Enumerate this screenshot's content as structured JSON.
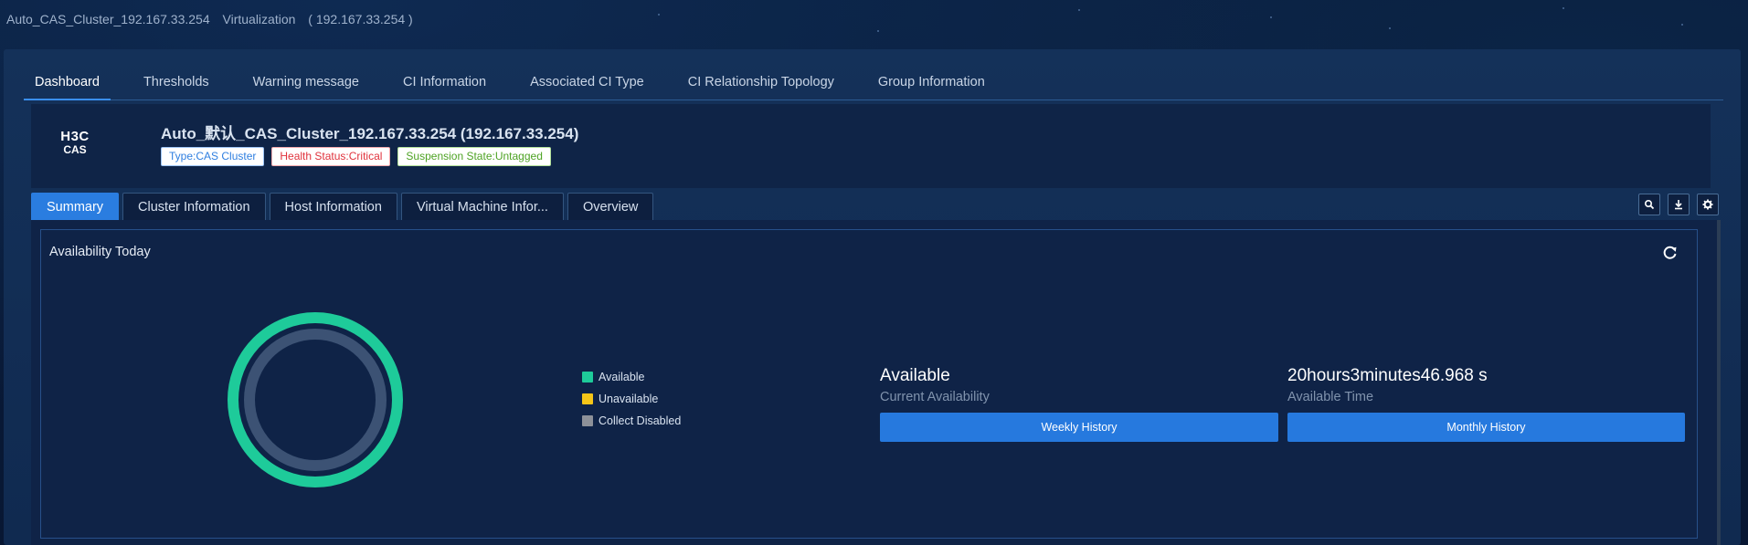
{
  "window": {
    "title_name": "Auto_CAS_Cluster_192.167.33.254",
    "title_category": "Virtualization",
    "title_ip": "( 192.167.33.254 )"
  },
  "main_tabs": [
    {
      "label": "Dashboard",
      "active": true
    },
    {
      "label": "Thresholds"
    },
    {
      "label": "Warning message"
    },
    {
      "label": "CI Information"
    },
    {
      "label": "Associated CI Type"
    },
    {
      "label": "CI Relationship Topology"
    },
    {
      "label": "Group Information"
    }
  ],
  "ci": {
    "logo_line1": "H3C",
    "logo_line2": "CAS",
    "title": "Auto_默认_CAS_Cluster_192.167.33.254 (192.167.33.254)",
    "badges": {
      "type": "Type:CAS Cluster",
      "health": "Health Status:Critical",
      "suspension": "Suspension State:Untagged"
    }
  },
  "sub_tabs": [
    {
      "label": "Summary",
      "active": true
    },
    {
      "label": "Cluster Information"
    },
    {
      "label": "Host Information"
    },
    {
      "label": "Virtual Machine Infor..."
    },
    {
      "label": "Overview"
    }
  ],
  "toolbar": {
    "icons": [
      "search-icon",
      "download-icon",
      "settings-icon"
    ]
  },
  "availability": {
    "title": "Availability Today",
    "chart_data": {
      "type": "pie",
      "categories": [
        "Available",
        "Unavailable",
        "Collect Disabled"
      ],
      "values": [
        100,
        0,
        0
      ],
      "colors": [
        "#1ecb9a",
        "#f5c518",
        "#8d9199"
      ],
      "legend_position": "right"
    },
    "current_value": "Available",
    "current_label": "Current Availability",
    "time_value": "20hours3minutes46.968 s",
    "time_label": "Available Time",
    "weekly_button": "Weekly History",
    "monthly_button": "Monthly History"
  }
}
